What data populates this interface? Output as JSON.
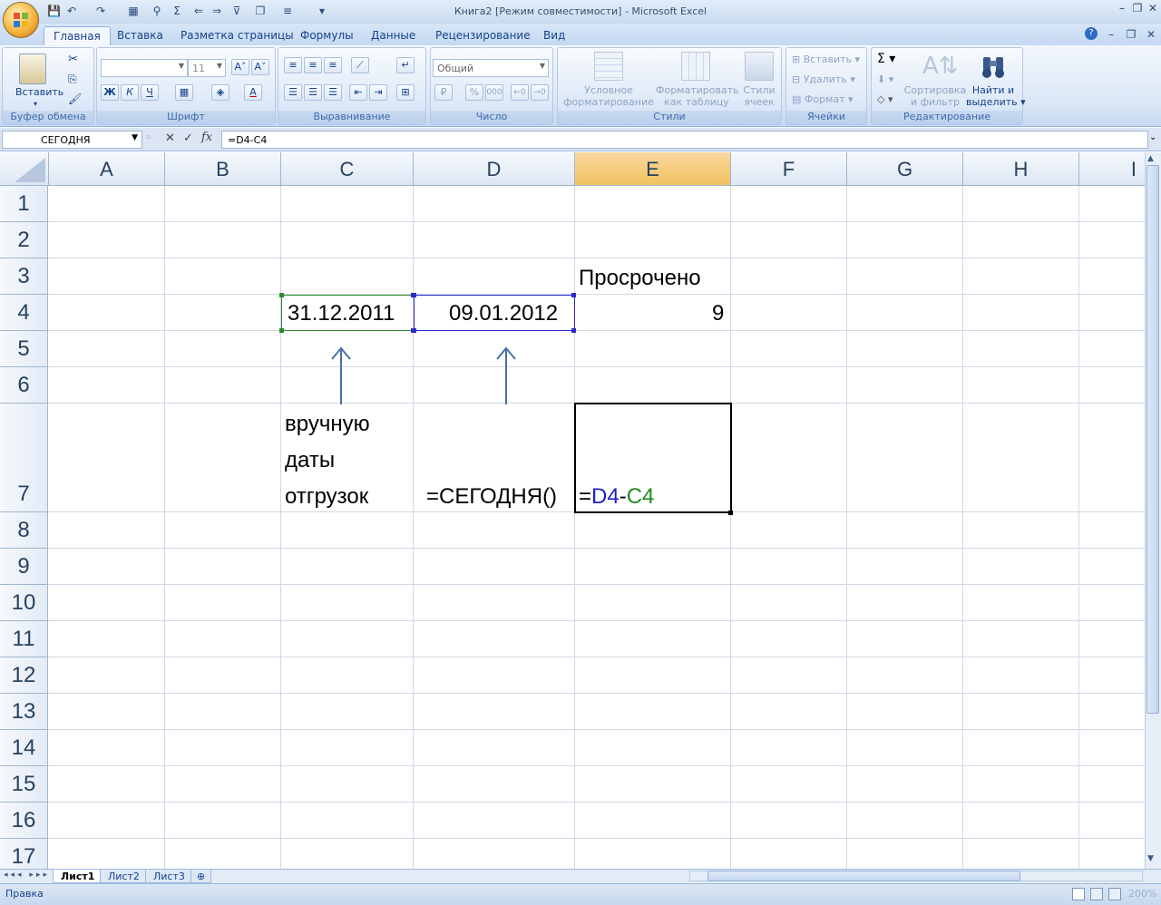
{
  "window": {
    "title": "Книга2  [Режим совместимости]  -  Microsoft Excel"
  },
  "ribbon_tabs": [
    "Главная",
    "Вставка",
    "Разметка страницы",
    "Формулы",
    "Данные",
    "Рецензирование",
    "Вид"
  ],
  "ribbon": {
    "clipboard": {
      "label": "Буфер обмена",
      "paste": "Вставить"
    },
    "font": {
      "label": "Шрифт",
      "size": "11",
      "bold": "Ж",
      "italic": "К",
      "underline": "Ч"
    },
    "alignment": {
      "label": "Выравнивание"
    },
    "number": {
      "label": "Число",
      "format": "Общий",
      "percent": "%",
      "thousands": "000"
    },
    "styles": {
      "label": "Стили",
      "conditional_1": "Условное",
      "conditional_2": "форматирование",
      "as_table_1": "Форматировать",
      "as_table_2": "как таблицу",
      "cell_styles_1": "Стили",
      "cell_styles_2": "ячеек"
    },
    "cells": {
      "label": "Ячейки",
      "insert": "Вставить",
      "delete": "Удалить",
      "format": "Формат"
    },
    "editing": {
      "label": "Редактирование",
      "sort_1": "Сортировка",
      "sort_2": "и фильтр",
      "find_1": "Найти и",
      "find_2": "выделить"
    }
  },
  "formula_bar": {
    "name_box": "СЕГОДНЯ",
    "formula": "=D4-C4"
  },
  "columns": [
    "A",
    "B",
    "C",
    "D",
    "E",
    "F",
    "G",
    "H",
    "I"
  ],
  "rows": [
    "1",
    "2",
    "3",
    "4",
    "5",
    "6",
    "7",
    "8",
    "9",
    "10",
    "11",
    "12",
    "13",
    "14",
    "15",
    "16",
    "17"
  ],
  "cells": {
    "E3": "Просрочено",
    "C4": "31.12.2011",
    "D4": "09.01.2012",
    "E4": "9",
    "C7_line1": "вручную",
    "C7_line2": "даты",
    "C7_line3": "отгрузок",
    "D7": "=СЕГОДНЯ()",
    "E7_eq": "=",
    "E7_ref1": "D4",
    "E7_minus": "-",
    "E7_ref2": "C4"
  },
  "sheet_tabs": [
    "Лист1",
    "Лист2",
    "Лист3"
  ],
  "active_sheet": "Лист1",
  "status": "Правка",
  "zoom": "200%",
  "colors": {
    "ref1": "#1f1fcc",
    "ref2": "#1f8a1f",
    "selected_header": "#f5c86d",
    "arrow": "#4a6fa5"
  }
}
